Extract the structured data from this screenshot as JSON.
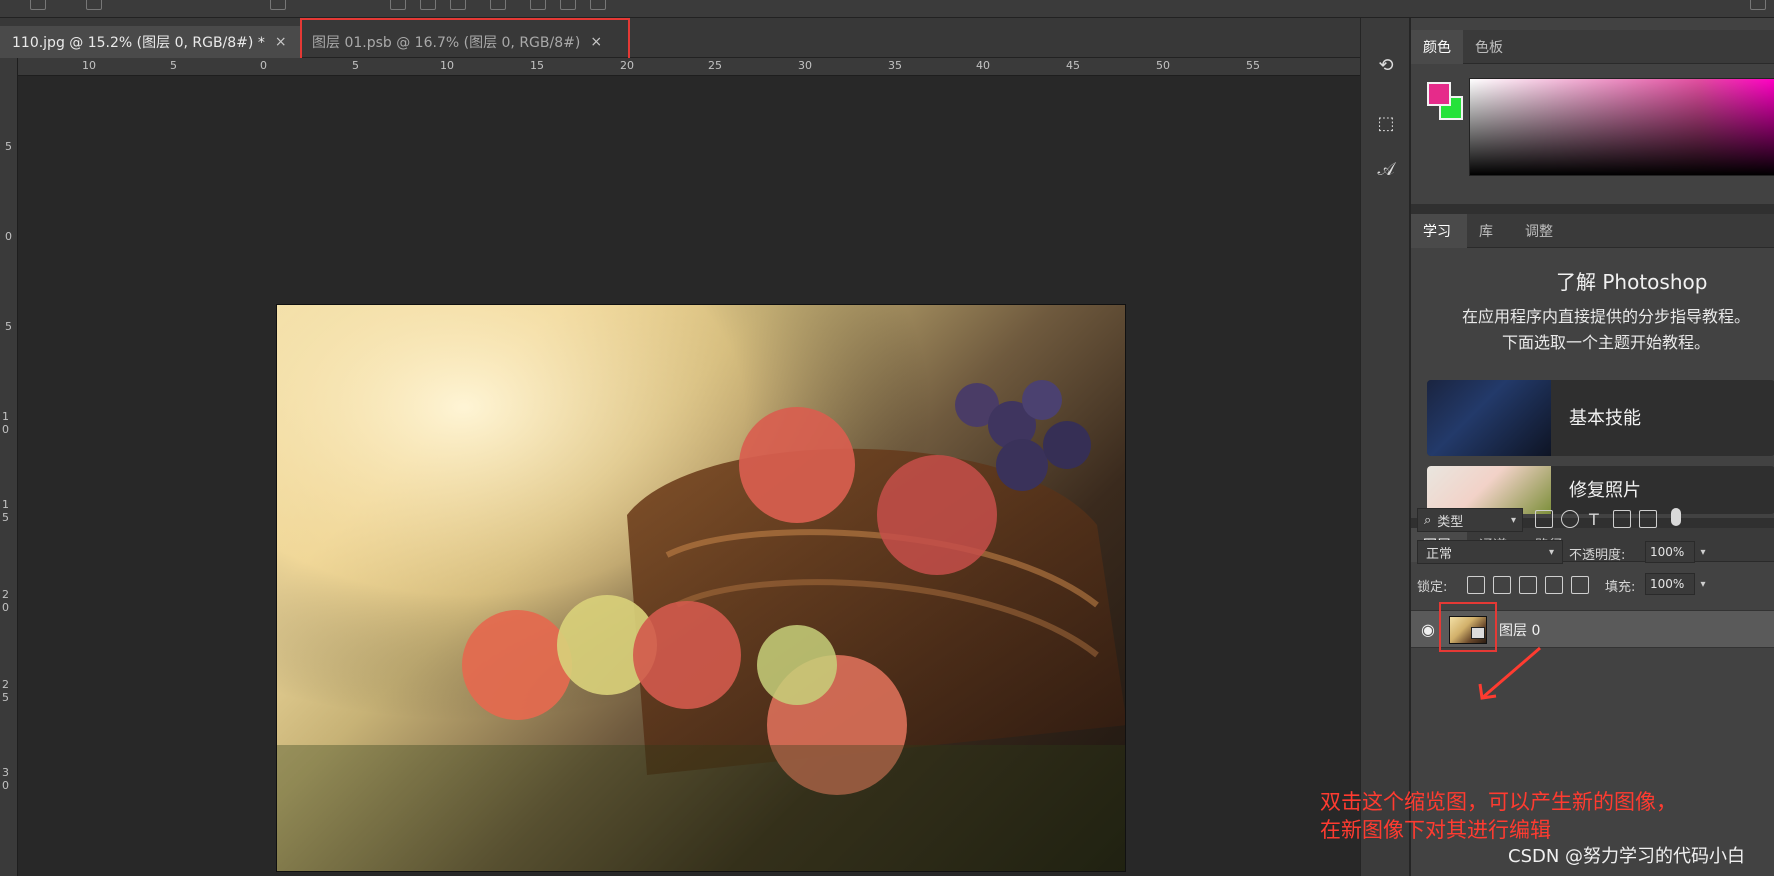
{
  "document_tabs": [
    {
      "label": "110.jpg @ 15.2% (图层 0, RGB/8#) *",
      "close": "×"
    },
    {
      "label": "图层 01.psb @ 16.7% (图层 0, RGB/8#)",
      "close": "×"
    }
  ],
  "ruler_h": [
    "10",
    "5",
    "0",
    "5",
    "10",
    "15",
    "20",
    "25",
    "30",
    "35",
    "40",
    "45",
    "50",
    "55"
  ],
  "ruler_v": [
    "5",
    "0",
    "5",
    "1\n0",
    "1\n5",
    "2\n0",
    "2\n5",
    "3\n0"
  ],
  "toolstrip_icons": [
    "history-icon",
    "3d-icon",
    "character-icon"
  ],
  "panels": {
    "color": {
      "tabs": [
        "颜色",
        "色板"
      ],
      "foreground": "#e62b8a",
      "background": "#26e23a"
    },
    "learn": {
      "tabs": [
        "学习",
        "库",
        "调整"
      ],
      "title": "了解 Photoshop",
      "desc": "在应用程序内直接提供的分步指导教程。\n下面选取一个主题开始教程。",
      "tutorials": [
        "基本技能",
        "修复照片"
      ]
    },
    "layers": {
      "tabs": [
        "图层",
        "通道",
        "路径"
      ],
      "filter": "类型",
      "blend_mode": "正常",
      "opacity_label": "不透明度:",
      "opacity_value": "100%",
      "lock_label": "锁定:",
      "fill_label": "填充:",
      "fill_value": "100%",
      "layer_name": "图层 0"
    }
  },
  "annotation": {
    "text": "双击这个缩览图，可以产生新的图像，\n在新图像下对其进行编辑",
    "color": "#ff3b30"
  },
  "watermark": "CSDN @努力学习的代码小白"
}
